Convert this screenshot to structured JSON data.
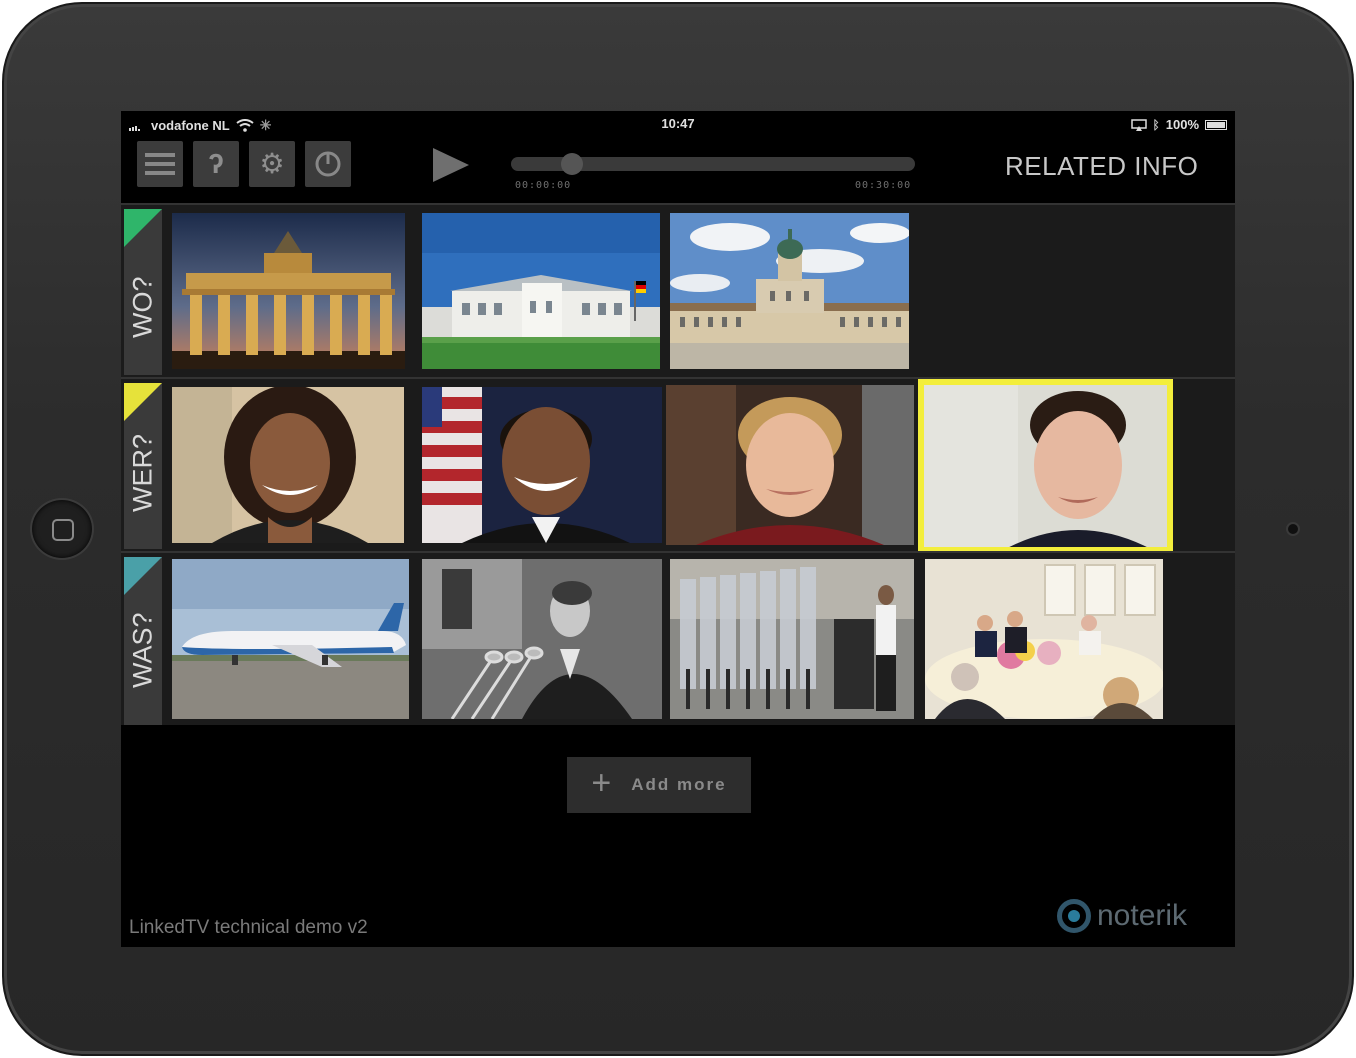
{
  "status_bar": {
    "carrier": "vodafone NL",
    "time": "10:47",
    "battery": "100%"
  },
  "toolbar": {
    "icons": [
      "menu-icon",
      "help-icon",
      "gear-icon",
      "power-icon",
      "play-icon"
    ],
    "time_start": "00:00:00",
    "time_end": "00:30:00",
    "progress": 0.13,
    "title": "RELATED INFO"
  },
  "rows": [
    {
      "label": "WO?",
      "accent": "#2fb56a",
      "tiles": [
        {
          "name": "brandenburg-gate-image",
          "highlight": false
        },
        {
          "name": "bellevue-palace-image",
          "highlight": false
        },
        {
          "name": "charlottenburg-palace-image",
          "highlight": false
        }
      ]
    },
    {
      "label": "WER?",
      "accent": "#e6e23a",
      "tiles": [
        {
          "name": "michelle-obama-image",
          "highlight": false
        },
        {
          "name": "barack-obama-image",
          "highlight": false
        },
        {
          "name": "angela-merkel-image",
          "highlight": false
        },
        {
          "name": "man-portrait-image",
          "highlight": true
        }
      ]
    },
    {
      "label": "WAS?",
      "accent": "#4aa0a8",
      "tiles": [
        {
          "name": "air-force-one-image",
          "highlight": false
        },
        {
          "name": "kennedy-speech-image",
          "highlight": false
        },
        {
          "name": "obama-speech-image",
          "highlight": false
        },
        {
          "name": "state-dinner-image",
          "highlight": false
        }
      ]
    }
  ],
  "add_more": {
    "label": "Add more",
    "icon": "plus-icon"
  },
  "footer": {
    "text": "LinkedTV technical demo v2"
  },
  "brand": {
    "name": "noterik"
  },
  "colors": {
    "highlight": "#f3ee3c",
    "screen_bg": "#000000",
    "device": "#2c2c2c"
  }
}
